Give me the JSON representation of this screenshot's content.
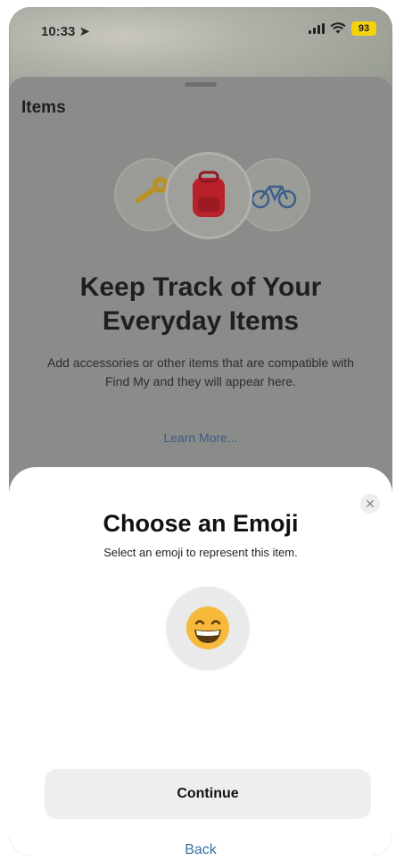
{
  "status_bar": {
    "time": "10:33",
    "battery": "93"
  },
  "background_page": {
    "title": "Items",
    "headline_line1": "Keep Track of Your",
    "headline_line2": "Everyday Items",
    "description": "Add accessories or other items that are compatible with Find My and they will appear here.",
    "learn_more": "Learn More...",
    "illustration_icons": [
      "key-icon",
      "backpack-icon",
      "bicycle-icon"
    ]
  },
  "modal": {
    "title": "Choose an Emoji",
    "subtitle": "Select an emoji to represent this item.",
    "selected_emoji": "😁",
    "close_label": "✕",
    "continue_label": "Continue",
    "back_label": "Back"
  },
  "colors": {
    "battery": "#f4d30c",
    "link": "#3d6fa8",
    "dim_overlay": "#8a8c89"
  }
}
